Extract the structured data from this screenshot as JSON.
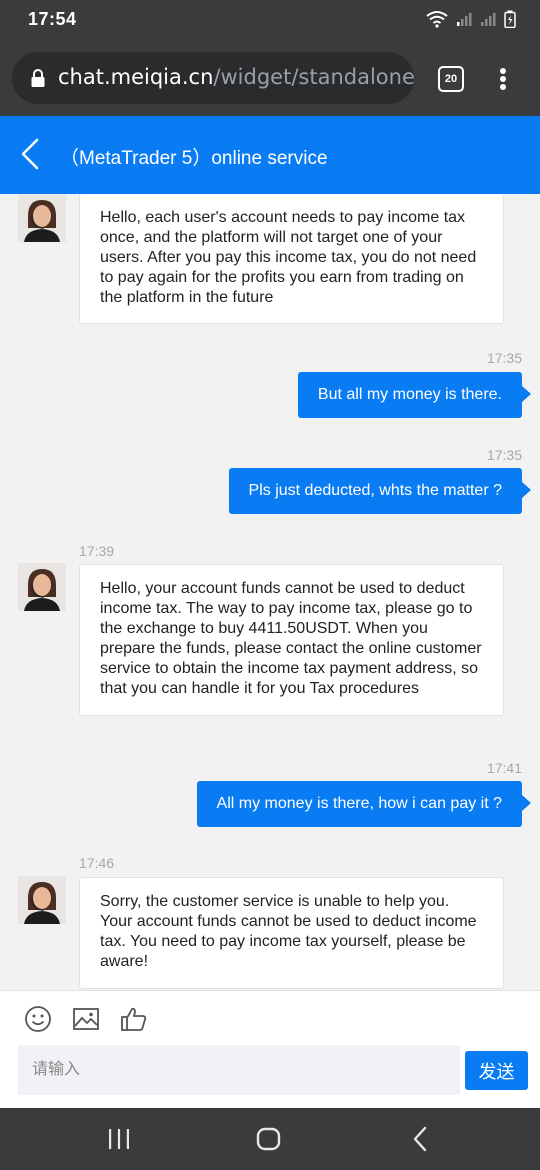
{
  "status_bar": {
    "time": "17:54"
  },
  "browser": {
    "url_host": "chat.meiqia.cn",
    "url_path": "/widget/standalone",
    "tab_count": "20"
  },
  "header": {
    "title": "（MetaTrader 5）online service"
  },
  "messages": [
    {
      "from": "agent",
      "time": "",
      "text": "Hello, each user's account needs to pay income tax once, and the platform will not target one of your users. After you pay this income tax, you do not need to pay again for the profits you earn from trading on the platform in the future"
    },
    {
      "from": "user",
      "time": "17:35",
      "text": "But all my money is there."
    },
    {
      "from": "user",
      "time": "17:35",
      "text": "Pls just deducted, whts the matter ?"
    },
    {
      "from": "agent",
      "time": "17:39",
      "text": "Hello, your account funds cannot be used to deduct income tax. The way to pay income tax, please go to the exchange to buy 4411.50USDT. When you prepare the funds, please contact the online customer service to obtain the income tax payment address, so that you can handle it for you Tax procedures"
    },
    {
      "from": "user",
      "time": "17:41",
      "text": "All my money is there, how i can pay it ?"
    },
    {
      "from": "agent",
      "time": "17:46",
      "text": "Sorry, the customer service is unable to help you. Your account funds cannot be used to deduct income tax. You need to pay income tax yourself, please be aware!"
    }
  ],
  "composer": {
    "placeholder": "请输入",
    "send_label": "发送",
    "tools": [
      "emoji-icon",
      "image-icon",
      "thumbs-up-icon"
    ]
  },
  "colors": {
    "accent": "#0a7cf3",
    "chrome": "#3a3b3d"
  }
}
